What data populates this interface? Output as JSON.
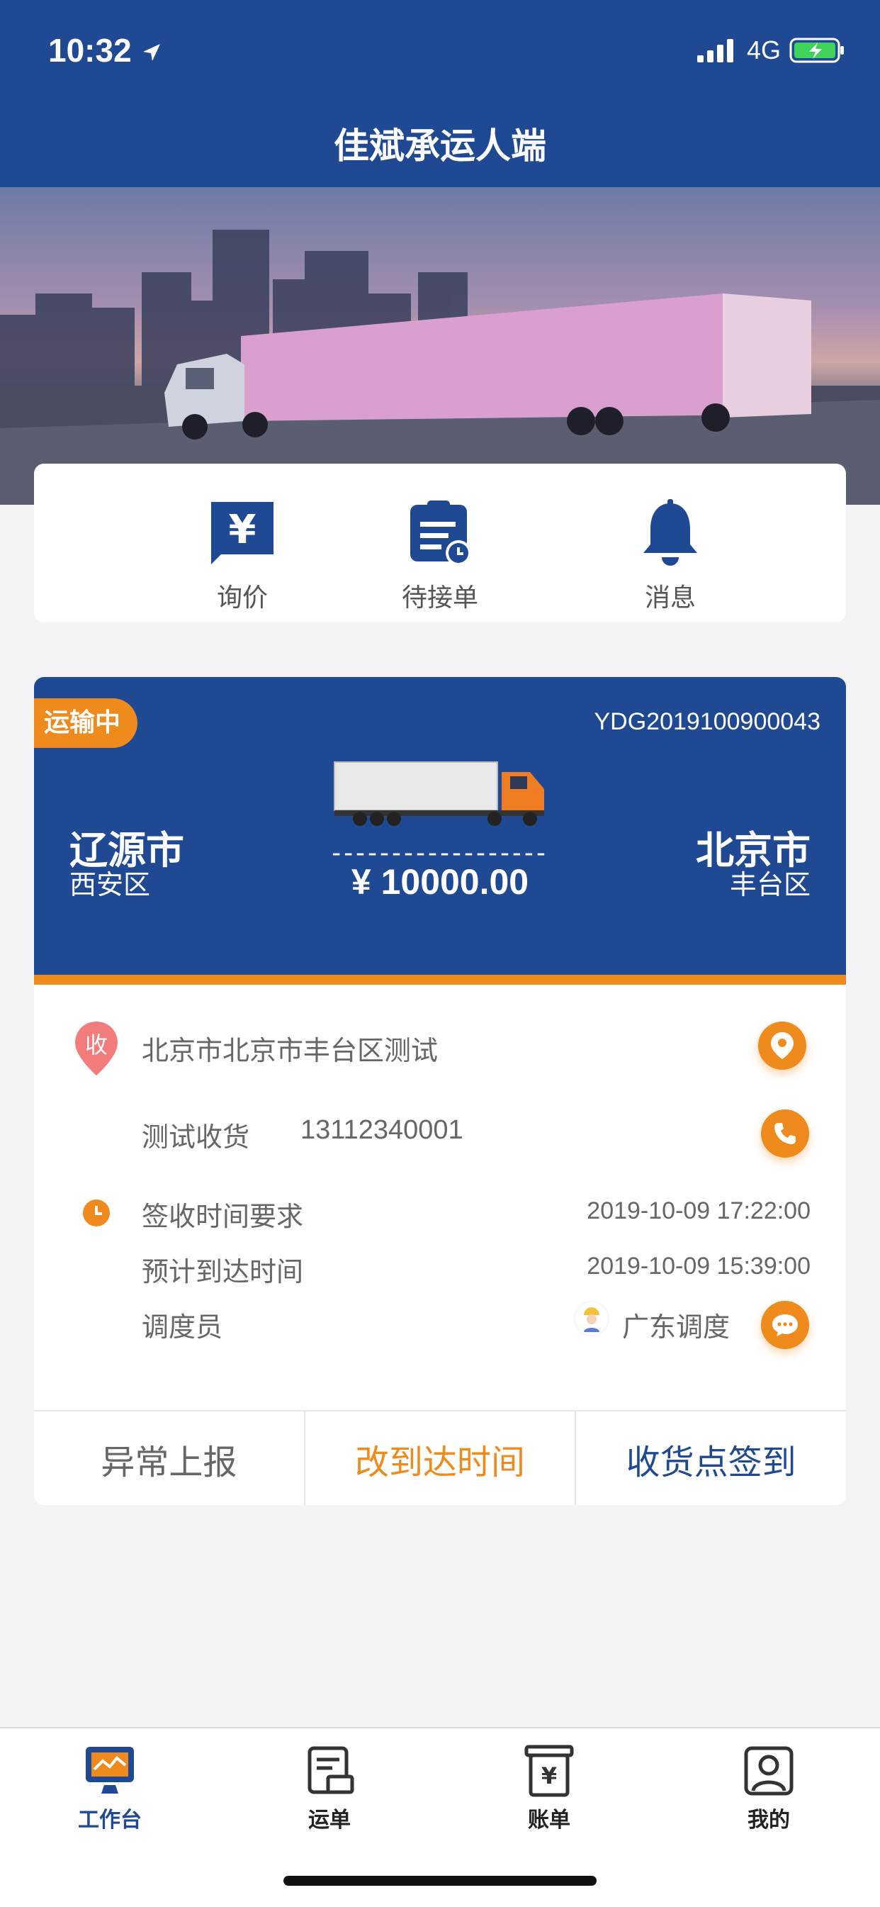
{
  "status_bar": {
    "time": "10:32",
    "network": "4G"
  },
  "header": {
    "title": "佳斌承运人端"
  },
  "quick_actions": [
    {
      "label": "询价",
      "icon": "yen-icon"
    },
    {
      "label": "待接单",
      "icon": "pending-order-icon"
    },
    {
      "label": "消息",
      "icon": "bell-icon"
    }
  ],
  "order": {
    "status": "运输中",
    "number": "YDG2019100900043",
    "origin_city": "辽源市",
    "origin_district": "西安区",
    "dest_city": "北京市",
    "dest_district": "丰台区",
    "dashes": "------------------",
    "price": "¥ 10000.00",
    "receiver_badge": "收",
    "address": "北京市北京市丰台区测试",
    "contact_name": "测试收货",
    "contact_phone": "13112340001",
    "sign_time_label": "签收时间要求",
    "sign_time_value": "2019-10-09 17:22:00",
    "eta_label": "预计到达时间",
    "eta_value": "2019-10-09 15:39:00",
    "dispatcher_label": "调度员",
    "dispatcher_name": "广东调度",
    "actions": {
      "report": "异常上报",
      "change_time": "改到达时间",
      "check_in": "收货点签到"
    }
  },
  "tabs": [
    {
      "label": "工作台",
      "icon": "dashboard-icon",
      "active": true
    },
    {
      "label": "运单",
      "icon": "waybill-icon",
      "active": false
    },
    {
      "label": "账单",
      "icon": "bill-icon",
      "active": false
    },
    {
      "label": "我的",
      "icon": "profile-icon",
      "active": false
    }
  ],
  "colors": {
    "primary": "#1f4a93",
    "accent": "#ef8a1d",
    "background": "#f4f4f6"
  }
}
